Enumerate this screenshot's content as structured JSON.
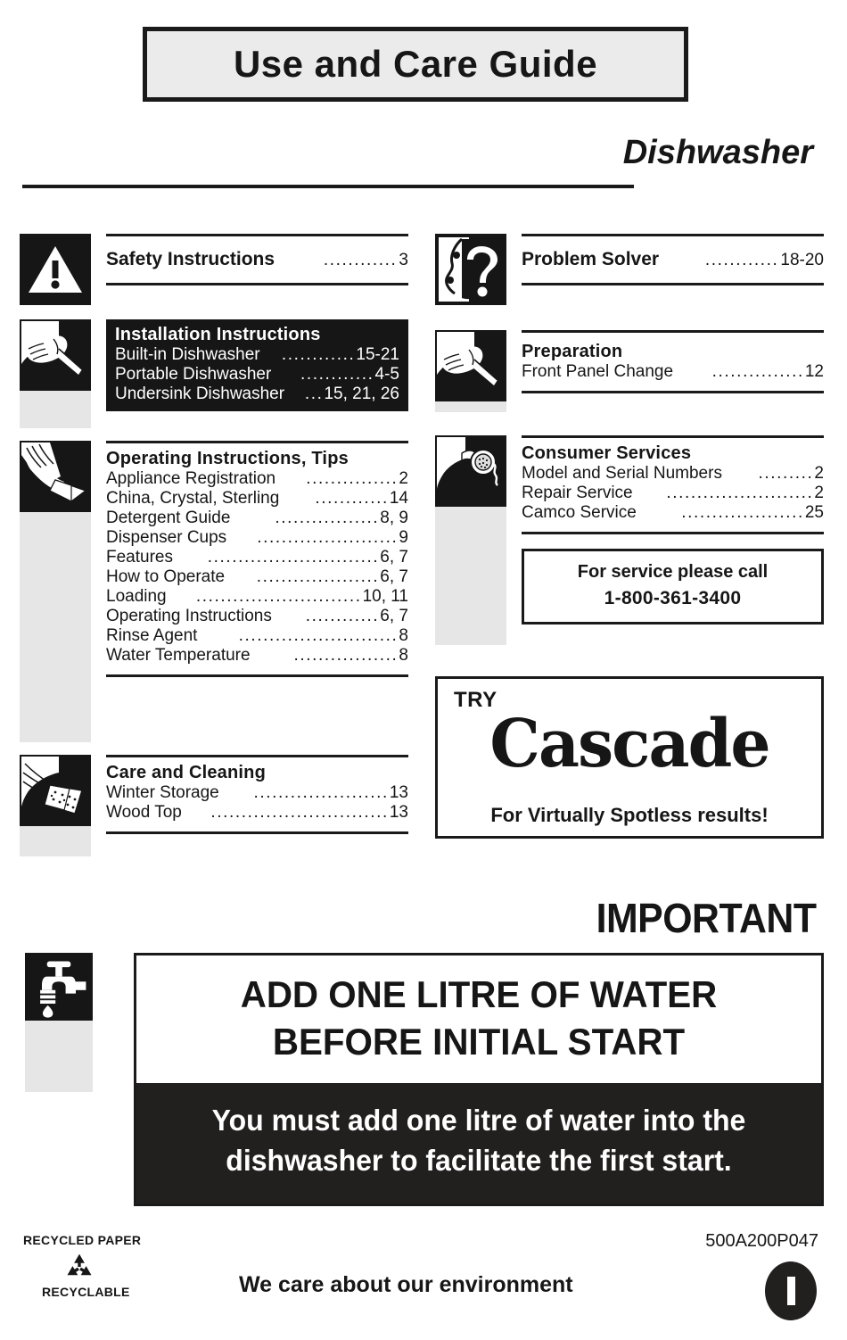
{
  "header": {
    "title": "Use and Care Guide",
    "subtitle": "Dishwasher"
  },
  "left_column": {
    "safety": {
      "icon": "warning-triangle-icon",
      "heading": "Safety Instructions",
      "leader": "............",
      "page": "3"
    },
    "installation": {
      "icon": "hand-screwdriver-icon",
      "heading": "Installation Instructions",
      "entries": [
        {
          "label": "Built-in Dishwasher",
          "leader": "............",
          "page": "15-21"
        },
        {
          "label": "Portable Dishwasher",
          "leader": "............",
          "page": "4-5"
        },
        {
          "label": "Undersink Dishwasher",
          "leader": "...",
          "page": "15, 21, 26"
        }
      ]
    },
    "operating": {
      "icon": "hand-press-button-icon",
      "heading": "Operating Instructions, Tips",
      "entries": [
        {
          "label": "Appliance Registration",
          "leader": "...............",
          "page": "2"
        },
        {
          "label": "China, Crystal, Sterling",
          "leader": "............",
          "page": "14"
        },
        {
          "label": "Detergent Guide",
          "leader": ".................",
          "page": "8, 9"
        },
        {
          "label": "Dispenser Cups",
          "leader": ".......................",
          "page": "9"
        },
        {
          "label": "Features",
          "leader": "............................",
          "page": "6, 7"
        },
        {
          "label": "How to Operate",
          "leader": "....................",
          "page": "6, 7"
        },
        {
          "label": "Loading",
          "leader": "...........................",
          "page": "10, 11"
        },
        {
          "label": "Operating Instructions",
          "leader": "............",
          "page": "6, 7"
        },
        {
          "label": "Rinse Agent",
          "leader": "..........................",
          "page": "8"
        },
        {
          "label": "Water Temperature",
          "leader": ".................",
          "page": "8"
        }
      ]
    },
    "care": {
      "icon": "hand-sponge-icon",
      "heading": "Care and Cleaning",
      "entries": [
        {
          "label": "Winter Storage",
          "leader": "......................",
          "page": "13"
        },
        {
          "label": "Wood Top",
          "leader": ".............................",
          "page": "13"
        }
      ]
    }
  },
  "right_column": {
    "problem_solver": {
      "icon": "face-question-mark-icon",
      "heading": "Problem Solver",
      "leader": "............",
      "page": "18-20"
    },
    "preparation": {
      "icon": "hand-screwdriver-icon",
      "heading": "Preparation",
      "entries": [
        {
          "label": "Front Panel Change",
          "leader": "...............",
          "page": "12"
        }
      ]
    },
    "consumer_services": {
      "icon": "phone-operator-icon",
      "heading": "Consumer Services",
      "entries": [
        {
          "label": "Model and Serial Numbers",
          "leader": ".........",
          "page": "2"
        },
        {
          "label": "Repair Service",
          "leader": "........................",
          "page": "2"
        },
        {
          "label": "Camco Service",
          "leader": "....................",
          "page": "25"
        }
      ]
    },
    "service_phone": {
      "line1": "For service please call",
      "line2": "1-800-361-3400"
    },
    "advertisement": {
      "try_label": "TRY",
      "brand": "Cascade",
      "tagline": "For Virtually Spotless results!"
    }
  },
  "important_notice": {
    "heading": "IMPORTANT",
    "icon": "faucet-water-drop-icon",
    "line1": "ADD ONE LITRE OF WATER",
    "line2": "BEFORE INITIAL START",
    "body": "You must add one litre of water into the dishwasher to facilitate the first start."
  },
  "footer": {
    "recycled_label": "RECYCLED PAPER",
    "recyclable_label": "RECYCLABLE",
    "recycle_icon": "recycle-mobius-icon",
    "environment_text": "We care about our environment",
    "part_number": "500A200P047",
    "badge": "I"
  }
}
